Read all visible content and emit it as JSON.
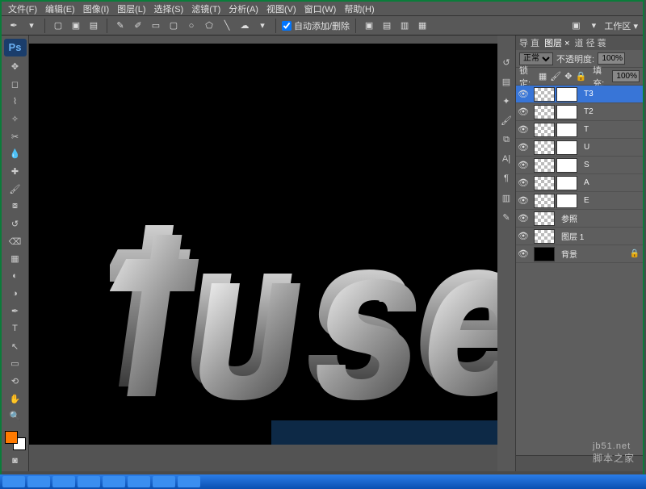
{
  "menu": {
    "file": "文件(F)",
    "edit": "编辑(E)",
    "image": "图像(I)",
    "layer": "图层(L)",
    "select": "选择(S)",
    "filter": "滤镜(T)",
    "analysis": "分析(A)",
    "view": "视图(V)",
    "window": "窗口(W)",
    "help": "帮助(H)"
  },
  "options": {
    "auto": "自动添加/删除"
  },
  "workspace": {
    "label": "工作区 ▾"
  },
  "toolbox": {
    "ps": "Ps"
  },
  "panel": {
    "tabs": {
      "nav": "导 直",
      "layers": "图层 ×",
      "channels": "道 径 蓑"
    },
    "blend": {
      "mode": "正常",
      "opacity_label": "不透明度:",
      "opacity": "100%",
      "lock_label": "锁定:",
      "fill_label": "填充:",
      "fill": "100%"
    }
  },
  "layers": [
    {
      "name": "T3",
      "sel": true,
      "mask": true
    },
    {
      "name": "T2",
      "mask": true
    },
    {
      "name": "T",
      "mask": true
    },
    {
      "name": "U",
      "mask": true
    },
    {
      "name": "S",
      "mask": true
    },
    {
      "name": "A",
      "mask": true
    },
    {
      "name": "E",
      "mask": true
    },
    {
      "name": "参照",
      "mask": false
    },
    {
      "name": "图层 1",
      "mask": false
    },
    {
      "name": "背景",
      "mask": false,
      "black": true,
      "locked": true
    }
  ],
  "canvas": {
    "text": "tuse"
  },
  "watermark": "jb51.net",
  "watermark_zh": "脚本之家"
}
